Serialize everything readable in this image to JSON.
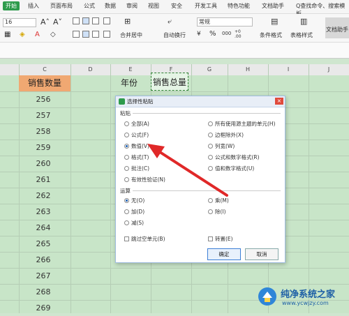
{
  "ribbon": {
    "tabs": [
      "开始",
      "插入",
      "页面布局",
      "公式",
      "数据",
      "审阅",
      "视图",
      "安全",
      "开发工具",
      "特色功能",
      "文档助手"
    ],
    "search": "Q查找命令、搜索模板"
  },
  "toolbar": {
    "font_size": "16",
    "merge_center": "合并居中",
    "wrap_text": "自动换行",
    "number_format": "常规",
    "percent": "%",
    "thousands": "000",
    "cond_format": "条件格式",
    "table_style": "表格样式",
    "doc_helper": "文档助手"
  },
  "sheet": {
    "columns": [
      "C",
      "D",
      "E",
      "F",
      "G",
      "H",
      "I",
      "J"
    ],
    "header_cell": "销售数量",
    "year_label": "年份",
    "sales_total_label": "销售总量",
    "values": [
      "256",
      "257",
      "258",
      "259",
      "260",
      "261",
      "262",
      "263",
      "264",
      "265",
      "266",
      "267",
      "268",
      "269"
    ]
  },
  "dialog": {
    "title": "选择性粘贴",
    "paste_section": "粘贴",
    "paste_options_left": [
      "全部(A)",
      "公式(F)",
      "数值(V)",
      "格式(T)",
      "批注(C)",
      "有效性验证(N)"
    ],
    "paste_options_right": [
      "所有使用源主题的单元(H)",
      "边框除外(X)",
      "列宽(W)",
      "公式和数字格式(R)",
      "值和数字格式(U)"
    ],
    "operation_section": "运算",
    "operation_left": [
      "无(O)",
      "加(D)",
      "减(S)"
    ],
    "operation_right": [
      "乘(M)",
      "除(I)"
    ],
    "skip_blanks": "跳过空单元(B)",
    "transpose": "转置(E)",
    "ok": "确定",
    "cancel": "取消",
    "selected_paste": "数值(V)",
    "selected_operation": "无(O)"
  },
  "watermark": {
    "line1": "纯净系统之家",
    "line2": "www.ycwjzy.com"
  },
  "colors": {
    "accent": "#2e9b4c",
    "header_fill": "#f0a872",
    "sheet_bg": "#c8e5c8",
    "arrow": "#e02828"
  }
}
